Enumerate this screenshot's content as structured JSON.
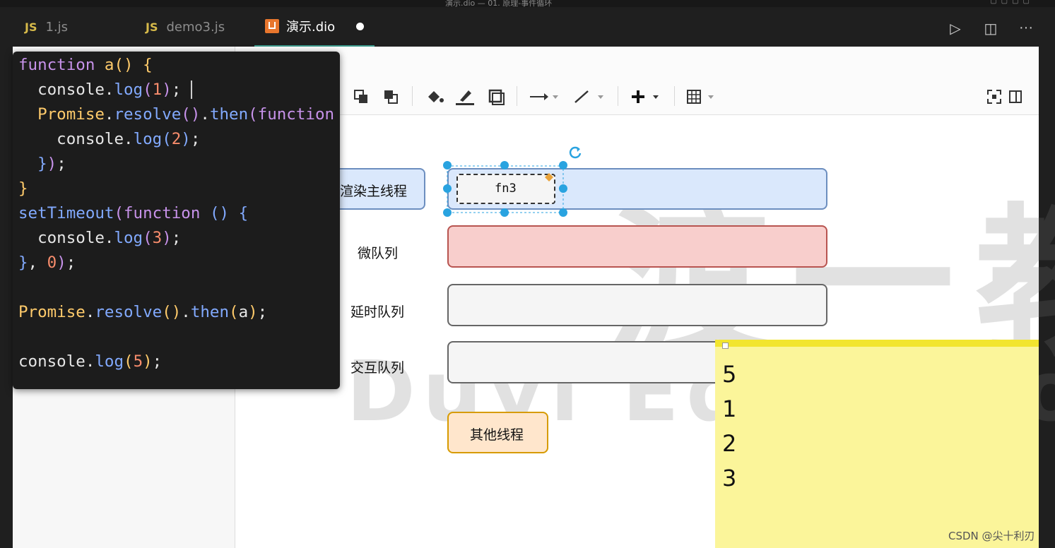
{
  "window": {
    "title": "演示.dio — 01. 原理-事件循环"
  },
  "tabs": [
    {
      "icon": "js-icon",
      "icon_text": "JS",
      "label": "1.js",
      "active": false
    },
    {
      "icon": "js-icon",
      "icon_text": "JS",
      "label": "demo3.js",
      "active": false
    },
    {
      "icon": "drawio-icon",
      "label": "演示.dio",
      "active": true,
      "unsaved": true
    }
  ],
  "tab_actions": [
    "run-icon",
    "split-editor-icon",
    "more-icon"
  ],
  "toolbar": {
    "icons": [
      "to-front-icon",
      "to-back-icon",
      "fill-color-icon",
      "line-color-icon",
      "shadow-icon",
      "connection-arrow-icon",
      "waypoints-icon",
      "insert-plus-icon",
      "table-icon",
      "fullscreen-icon",
      "format-panel-icon"
    ]
  },
  "diagram": {
    "rows": [
      {
        "label": "渲染主线程",
        "color": "#dae8fc",
        "border": "#6c8ebf"
      },
      {
        "label": "微队列",
        "color": "#f8cecc",
        "border": "#b85450"
      },
      {
        "label": "延时队列",
        "color": "#f5f5f5",
        "border": "#666666"
      },
      {
        "label": "交互队列",
        "color": "#f5f5f5",
        "border": "#666666"
      }
    ],
    "task": {
      "label": "fn3"
    },
    "other_thread": {
      "label": "其他线程",
      "color": "#ffe6cc",
      "border": "#d79b00"
    }
  },
  "code": {
    "lines": [
      "function a() {",
      "  console.log(1);",
      "  Promise.resolve().then(function",
      "    console.log(2);",
      "  });",
      "}",
      "setTimeout(function () {",
      "  console.log(3);",
      "}, 0);",
      "",
      "Promise.resolve().then(a);",
      "",
      "console.log(5);"
    ]
  },
  "output_note": {
    "values": [
      "5",
      "1",
      "2",
      "3"
    ]
  },
  "watermark": {
    "cn": "渡一教育",
    "en": "Duyi Education"
  },
  "credit": "CSDN @尖十利刃"
}
